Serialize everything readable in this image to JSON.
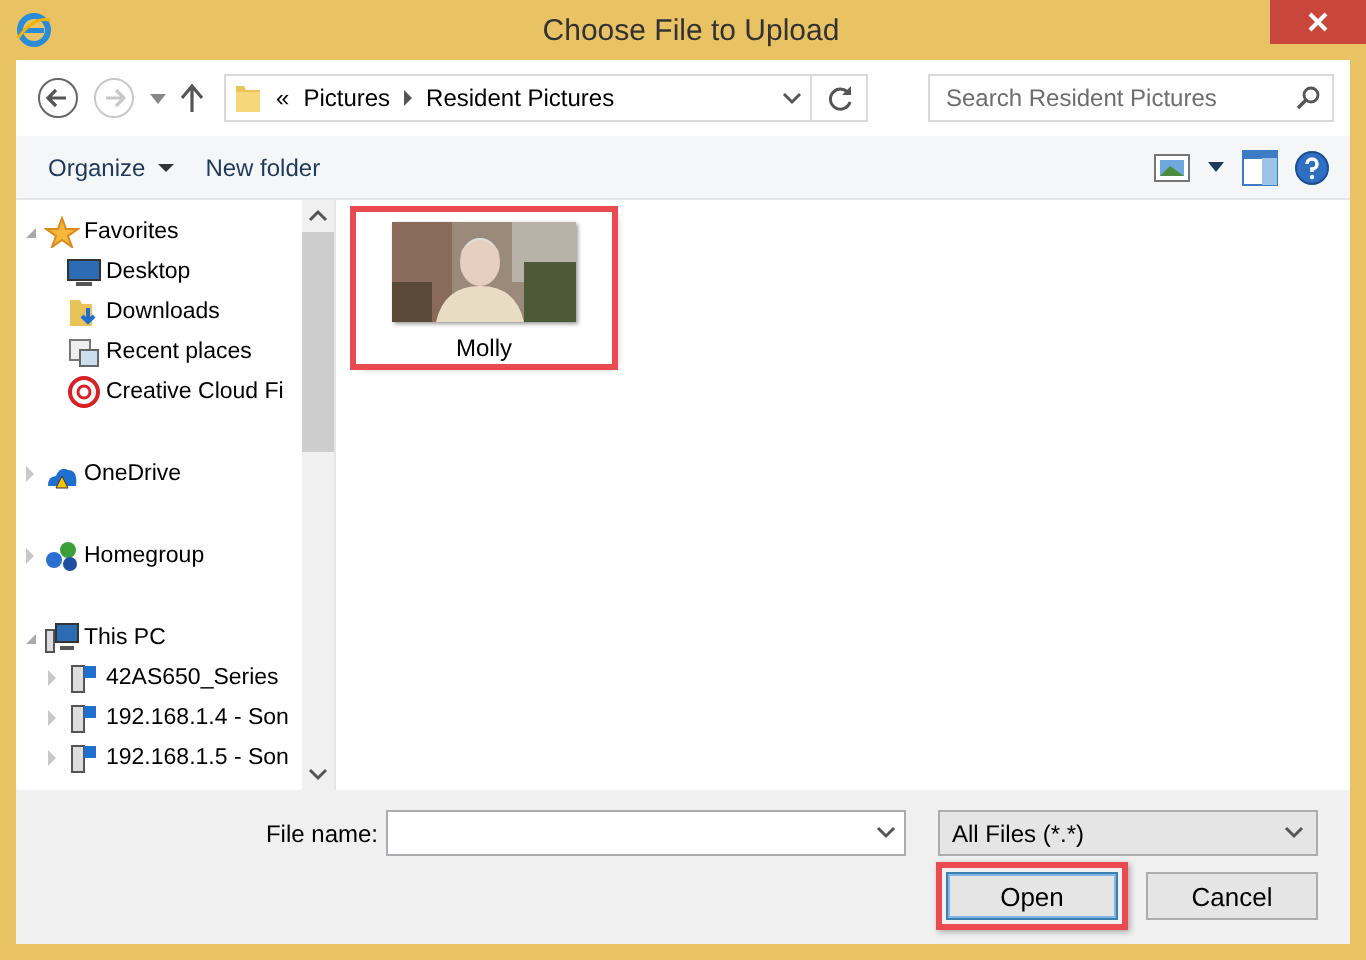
{
  "window": {
    "title": "Choose File to Upload"
  },
  "address_bar": {
    "overflow": "«",
    "path": [
      "Pictures",
      "Resident Pictures"
    ]
  },
  "search": {
    "placeholder": "Search Resident Pictures"
  },
  "toolbar": {
    "organize": "Organize",
    "new_folder": "New folder"
  },
  "sidebar": {
    "items": [
      {
        "label": "Favorites",
        "kind": "star",
        "expanded": true,
        "children": [
          {
            "label": "Desktop",
            "kind": "monitor"
          },
          {
            "label": "Downloads",
            "kind": "download"
          },
          {
            "label": "Recent places",
            "kind": "places"
          },
          {
            "label": "Creative Cloud Fi",
            "kind": "cloudapp"
          }
        ]
      },
      {
        "label": "OneDrive",
        "kind": "cloud",
        "expanded": false
      },
      {
        "label": "Homegroup",
        "kind": "network",
        "expanded": false
      },
      {
        "label": "This PC",
        "kind": "computer",
        "expanded": true,
        "children": [
          {
            "label": "42AS650_Series",
            "kind": "device",
            "expanded": false
          },
          {
            "label": "192.168.1.4 - Son",
            "kind": "device",
            "expanded": false
          },
          {
            "label": "192.168.1.5 - Son",
            "kind": "device",
            "expanded": false
          }
        ]
      }
    ]
  },
  "files": [
    {
      "name": "Molly",
      "kind": "picture",
      "highlighted": true
    }
  ],
  "file_name": {
    "label": "File name:"
  },
  "file_type": {
    "value": "All Files (*.*)"
  },
  "buttons": [
    {
      "label": "Open",
      "default": true,
      "highlighted": true
    },
    {
      "label": "Cancel",
      "default": false,
      "highlighted": false
    }
  ]
}
